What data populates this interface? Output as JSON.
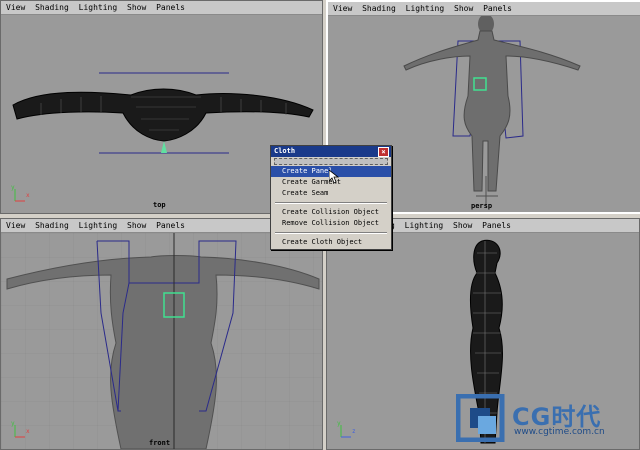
{
  "menu_items": [
    "View",
    "Shading",
    "Lighting",
    "Show",
    "Panels"
  ],
  "viewports": {
    "top": {
      "label": "top"
    },
    "persp": {
      "label": "persp"
    },
    "front": {
      "label": "front"
    },
    "side": {
      "label": ""
    }
  },
  "axis": {
    "y": "y",
    "x": "x",
    "z": "z"
  },
  "cloth_menu": {
    "title": "Cloth",
    "close_glyph": "×",
    "group1": [
      "Create Panel",
      "Create Garment",
      "Create Seam"
    ],
    "group2": [
      "Create Collision Object",
      "Remove Collision Object"
    ],
    "group3": [
      "Create Cloth Object"
    ],
    "selected": "Create Panel"
  },
  "watermark": {
    "brand": "CG时代",
    "url": "www.cgtime.com.cn"
  },
  "colors": {
    "viewport_bg": "#9a9a9a",
    "menu_title": "#1a3a8a",
    "selection": "#2a4fa8",
    "panel_outline": "#2a2a8a",
    "seam_green": "#40e090",
    "brand_blue": "#3a6fb0"
  }
}
